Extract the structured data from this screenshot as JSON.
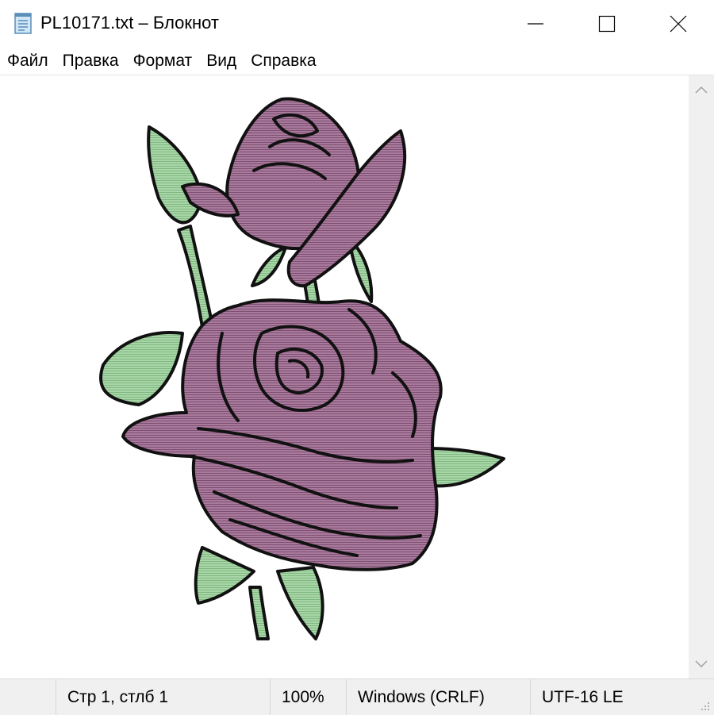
{
  "window": {
    "title": "PL10171.txt – Блокнот",
    "app_icon": "notepad-icon",
    "controls": [
      "minimize-icon",
      "maximize-icon",
      "close-icon"
    ]
  },
  "menu": {
    "items": [
      {
        "label": "Файл"
      },
      {
        "label": "Правка"
      },
      {
        "label": "Формат"
      },
      {
        "label": "Вид"
      },
      {
        "label": "Справка"
      }
    ]
  },
  "editor": {
    "content_description_icon": "rose-ascii-art",
    "colors": {
      "petal": "#9b6b8f",
      "leaf": "#9fcf9f",
      "outline": "#111111"
    }
  },
  "scrollbar": {
    "up_icon": "chevron-up-icon",
    "down_icon": "chevron-down-icon"
  },
  "status": {
    "position": "Стр 1, стлб 1",
    "zoom": "100%",
    "line_endings": "Windows (CRLF)",
    "encoding": "UTF-16 LE"
  },
  "colors": {
    "chrome": "#f0f0f0",
    "background": "#ffffff"
  }
}
